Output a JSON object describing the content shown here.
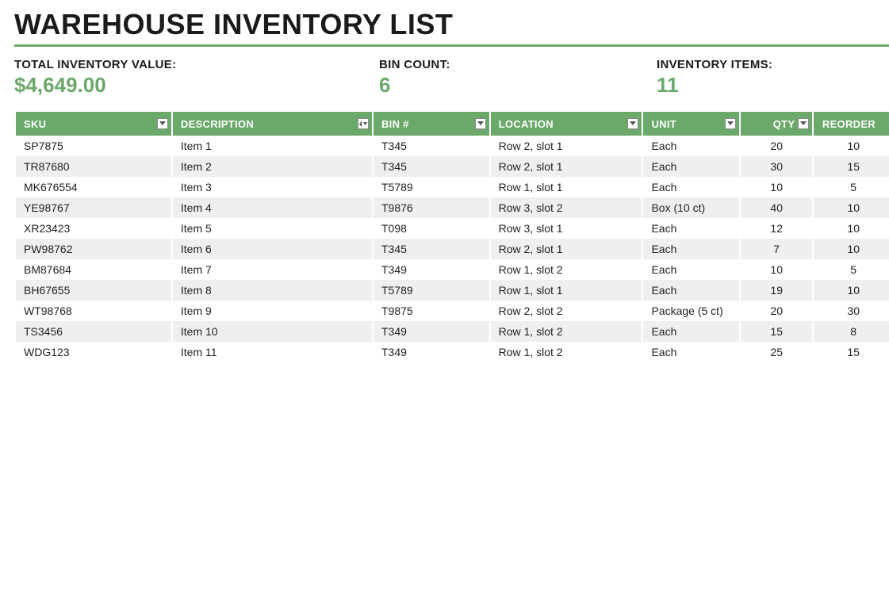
{
  "title": "WAREHOUSE INVENTORY LIST",
  "summary": {
    "total_label": "TOTAL INVENTORY VALUE:",
    "total_value": "$4,649.00",
    "bin_label": "BIN COUNT:",
    "bin_value": "6",
    "items_label": "INVENTORY ITEMS:",
    "items_value": "11"
  },
  "columns": {
    "sku": "SKU",
    "desc": "DESCRIPTION",
    "bin": "BIN #",
    "loc": "LOCATION",
    "unit": "UNIT",
    "qty": "QTY",
    "reorder": "REORDER"
  },
  "rows": [
    {
      "sku": "SP7875",
      "desc": "Item 1",
      "bin": "T345",
      "loc": "Row 2, slot 1",
      "unit": "Each",
      "qty": "20",
      "reorder": "10"
    },
    {
      "sku": "TR87680",
      "desc": "Item 2",
      "bin": "T345",
      "loc": "Row 2, slot 1",
      "unit": "Each",
      "qty": "30",
      "reorder": "15"
    },
    {
      "sku": "MK676554",
      "desc": "Item 3",
      "bin": "T5789",
      "loc": "Row 1, slot 1",
      "unit": "Each",
      "qty": "10",
      "reorder": "5"
    },
    {
      "sku": "YE98767",
      "desc": "Item 4",
      "bin": "T9876",
      "loc": "Row 3, slot 2",
      "unit": "Box (10 ct)",
      "qty": "40",
      "reorder": "10"
    },
    {
      "sku": "XR23423",
      "desc": "Item 5",
      "bin": "T098",
      "loc": "Row 3, slot 1",
      "unit": "Each",
      "qty": "12",
      "reorder": "10"
    },
    {
      "sku": "PW98762",
      "desc": "Item 6",
      "bin": "T345",
      "loc": "Row 2, slot 1",
      "unit": "Each",
      "qty": "7",
      "reorder": "10"
    },
    {
      "sku": "BM87684",
      "desc": "Item 7",
      "bin": "T349",
      "loc": "Row 1, slot 2",
      "unit": "Each",
      "qty": "10",
      "reorder": "5"
    },
    {
      "sku": "BH67655",
      "desc": "Item 8",
      "bin": "T5789",
      "loc": "Row 1, slot 1",
      "unit": "Each",
      "qty": "19",
      "reorder": "10"
    },
    {
      "sku": "WT98768",
      "desc": "Item 9",
      "bin": "T9875",
      "loc": "Row 2, slot 2",
      "unit": "Package (5 ct)",
      "qty": "20",
      "reorder": "30"
    },
    {
      "sku": "TS3456",
      "desc": "Item 10",
      "bin": "T349",
      "loc": "Row 1, slot 2",
      "unit": "Each",
      "qty": "15",
      "reorder": "8"
    },
    {
      "sku": "WDG123",
      "desc": "Item 11",
      "bin": "T349",
      "loc": "Row 1, slot 2",
      "unit": "Each",
      "qty": "25",
      "reorder": "15"
    }
  ]
}
